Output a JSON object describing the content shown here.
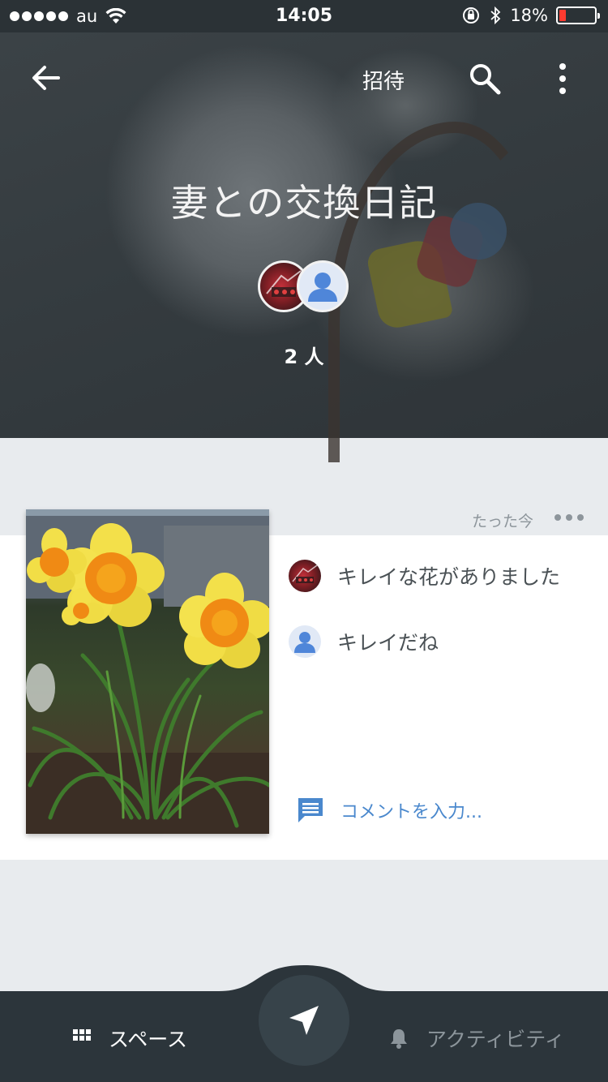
{
  "status_bar": {
    "carrier": "au",
    "time": "14:05",
    "battery_percent": "18%",
    "battery_level": 0.18,
    "icons": [
      "signal-dots",
      "wifi-icon",
      "orientation-lock-icon",
      "bluetooth-icon",
      "battery-icon"
    ]
  },
  "header": {
    "back_icon": "arrow-left-icon",
    "invite_label": "招待",
    "search_icon": "search-icon",
    "more_icon": "more-vertical-icon",
    "space_title": "妻との交換日記",
    "member_count": "2 人"
  },
  "post": {
    "time": "たった今",
    "more_icon": "more-horizontal-icon",
    "image": "daffodil-photo",
    "comments": [
      {
        "avatar": "photo-avatar",
        "text": "キレイな花がありました"
      },
      {
        "avatar": "default-avatar",
        "text": "キレイだね"
      }
    ],
    "comment_placeholder": "コメントを入力..."
  },
  "bottom_nav": {
    "spaces_label": "スペース",
    "activity_label": "アクティビティ",
    "send_icon": "send-icon"
  },
  "colors": {
    "header_bg": "#2b3236",
    "bottom_bar": "#2c353b",
    "fab": "#37434a",
    "accent_blue": "#4a88cd",
    "page_bg": "#e8ebee",
    "battery_low": "#ff3b30"
  }
}
